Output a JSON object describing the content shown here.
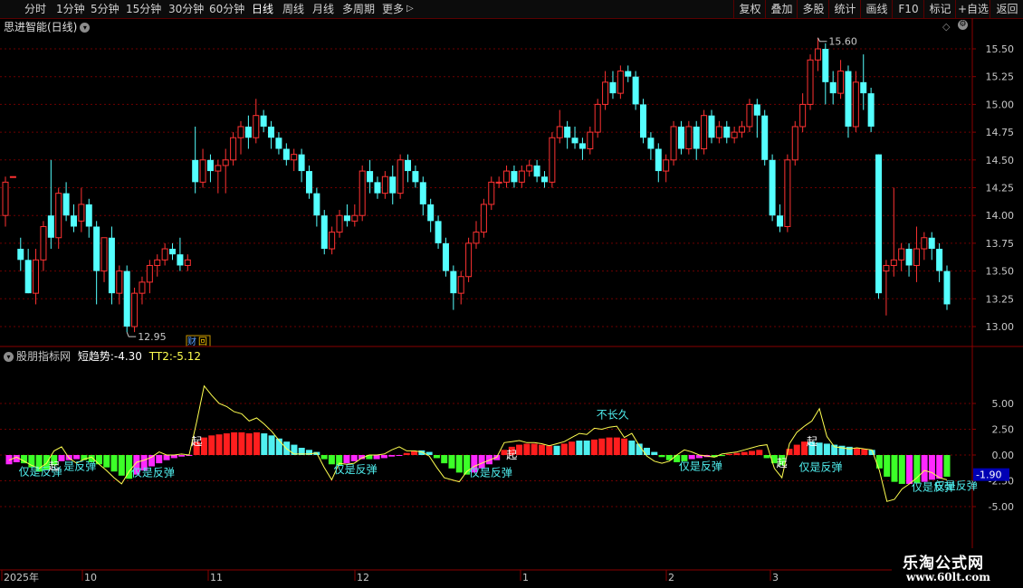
{
  "toolbar": {
    "periods": [
      "分时",
      "1分钟",
      "5分钟",
      "15分钟",
      "30分钟",
      "60分钟",
      "日线",
      "周线",
      "月线",
      "多周期",
      "更多"
    ],
    "active_period": "日线",
    "buttons": [
      "复权",
      "叠加",
      "多股",
      "统计",
      "画线",
      "F10",
      "标记",
      "+自选",
      "返回"
    ]
  },
  "main": {
    "title": "思进智能(日线)",
    "price_ticks": [
      "15.50",
      "15.25",
      "15.00",
      "14.75",
      "14.50",
      "14.25",
      "14.00",
      "13.75",
      "13.50",
      "13.25",
      "13.00"
    ],
    "high_label": "15.60",
    "low_label": "12.95",
    "badge": "财",
    "badge2": "回",
    "colors": {
      "up": "#ff3232",
      "down": "#54ffff",
      "grid": "#6e0000"
    },
    "candles": [
      [
        14.0,
        14.3,
        13.9,
        14.35
      ],
      [
        14.35,
        14.35,
        13.7,
        13.7
      ],
      [
        13.7,
        13.6,
        13.5,
        13.8
      ],
      [
        13.6,
        13.3,
        13.3,
        13.7
      ],
      [
        13.3,
        13.6,
        13.2,
        13.7
      ],
      [
        13.6,
        13.9,
        13.5,
        13.95
      ],
      [
        14.0,
        13.8,
        13.7,
        14.5
      ],
      [
        13.8,
        14.2,
        13.7,
        14.25
      ],
      [
        14.2,
        14.0,
        13.95,
        14.3
      ],
      [
        14.0,
        13.9,
        13.85,
        14.1
      ],
      [
        13.95,
        14.1,
        13.85,
        14.25
      ],
      [
        14.1,
        13.9,
        13.8,
        14.15
      ],
      [
        13.9,
        13.5,
        13.2,
        13.95
      ],
      [
        13.5,
        13.8,
        13.4,
        13.8
      ],
      [
        13.8,
        13.3,
        13.2,
        13.9
      ],
      [
        13.3,
        13.5,
        13.2,
        13.55
      ],
      [
        13.5,
        13.0,
        12.95,
        13.55
      ],
      [
        13.0,
        13.3,
        12.95,
        13.35
      ],
      [
        13.3,
        13.4,
        13.2,
        13.45
      ],
      [
        13.4,
        13.55,
        13.3,
        13.6
      ],
      [
        13.55,
        13.6,
        13.45,
        13.65
      ],
      [
        13.6,
        13.7,
        13.55,
        13.75
      ],
      [
        13.7,
        13.65,
        13.6,
        13.75
      ],
      [
        13.65,
        13.55,
        13.5,
        13.8
      ],
      [
        13.55,
        13.6,
        13.5,
        13.65
      ],
      [
        14.5,
        14.3,
        14.2,
        14.8
      ],
      [
        14.3,
        14.5,
        14.25,
        14.6
      ],
      [
        14.5,
        14.4,
        14.3,
        14.55
      ],
      [
        14.4,
        14.45,
        14.2,
        14.5
      ],
      [
        14.45,
        14.5,
        14.2,
        14.6
      ],
      [
        14.5,
        14.7,
        14.45,
        14.75
      ],
      [
        14.7,
        14.8,
        14.55,
        14.85
      ],
      [
        14.8,
        14.7,
        14.6,
        14.9
      ],
      [
        14.7,
        14.9,
        14.65,
        15.05
      ],
      [
        14.9,
        14.8,
        14.75,
        14.95
      ],
      [
        14.8,
        14.7,
        14.6,
        14.85
      ],
      [
        14.7,
        14.6,
        14.55,
        14.75
      ],
      [
        14.6,
        14.5,
        14.45,
        14.65
      ],
      [
        14.5,
        14.55,
        14.4,
        14.6
      ],
      [
        14.55,
        14.4,
        14.3,
        14.6
      ],
      [
        14.4,
        14.2,
        14.15,
        14.45
      ],
      [
        14.2,
        14.0,
        13.9,
        14.25
      ],
      [
        14.0,
        13.7,
        13.65,
        14.05
      ],
      [
        13.7,
        13.85,
        13.65,
        13.9
      ],
      [
        13.85,
        14.0,
        13.8,
        14.05
      ],
      [
        14.0,
        13.95,
        13.9,
        14.1
      ],
      [
        13.95,
        14.0,
        13.9,
        14.1
      ],
      [
        14.0,
        14.4,
        13.95,
        14.45
      ],
      [
        14.4,
        14.3,
        14.2,
        14.5
      ],
      [
        14.3,
        14.2,
        14.15,
        14.35
      ],
      [
        14.2,
        14.35,
        14.15,
        14.4
      ],
      [
        14.35,
        14.2,
        14.1,
        14.45
      ],
      [
        14.2,
        14.5,
        14.15,
        14.55
      ],
      [
        14.5,
        14.4,
        14.3,
        14.55
      ],
      [
        14.4,
        14.3,
        14.25,
        14.45
      ],
      [
        14.3,
        14.1,
        14.0,
        14.35
      ],
      [
        14.1,
        13.95,
        13.85,
        14.15
      ],
      [
        13.95,
        13.75,
        13.7,
        14.0
      ],
      [
        13.75,
        13.5,
        13.45,
        13.8
      ],
      [
        13.5,
        13.3,
        13.15,
        13.55
      ],
      [
        13.3,
        13.45,
        13.2,
        13.5
      ],
      [
        13.45,
        13.75,
        13.4,
        13.8
      ],
      [
        13.75,
        13.85,
        13.7,
        13.95
      ],
      [
        13.85,
        14.1,
        13.8,
        14.15
      ],
      [
        14.1,
        14.3,
        14.05,
        14.35
      ],
      [
        14.3,
        14.3,
        14.25,
        14.35
      ],
      [
        14.3,
        14.4,
        14.25,
        14.45
      ],
      [
        14.4,
        14.3,
        14.25,
        14.45
      ],
      [
        14.3,
        14.4,
        14.25,
        14.45
      ],
      [
        14.4,
        14.45,
        14.35,
        14.5
      ],
      [
        14.45,
        14.35,
        14.3,
        14.5
      ],
      [
        14.35,
        14.3,
        14.25,
        14.4
      ],
      [
        14.3,
        14.7,
        14.25,
        14.75
      ],
      [
        14.7,
        14.8,
        14.65,
        14.95
      ],
      [
        14.8,
        14.7,
        14.6,
        14.85
      ],
      [
        14.7,
        14.65,
        14.6,
        14.8
      ],
      [
        14.65,
        14.6,
        14.5,
        14.7
      ],
      [
        14.6,
        14.75,
        14.55,
        14.8
      ],
      [
        14.75,
        15.0,
        14.7,
        15.05
      ],
      [
        15.0,
        15.2,
        14.95,
        15.3
      ],
      [
        15.2,
        15.1,
        15.05,
        15.3
      ],
      [
        15.1,
        15.3,
        15.05,
        15.35
      ],
      [
        15.3,
        15.25,
        15.2,
        15.35
      ],
      [
        15.25,
        15.0,
        14.95,
        15.3
      ],
      [
        15.0,
        14.7,
        14.65,
        15.05
      ],
      [
        14.7,
        14.6,
        14.5,
        14.75
      ],
      [
        14.6,
        14.4,
        14.3,
        14.65
      ],
      [
        14.4,
        14.5,
        14.3,
        14.55
      ],
      [
        14.5,
        14.8,
        14.45,
        14.85
      ],
      [
        14.8,
        14.6,
        14.55,
        14.85
      ],
      [
        14.6,
        14.8,
        14.55,
        14.85
      ],
      [
        14.8,
        14.6,
        14.5,
        14.85
      ],
      [
        14.6,
        14.9,
        14.55,
        14.95
      ],
      [
        14.9,
        14.7,
        14.65,
        14.95
      ],
      [
        14.7,
        14.8,
        14.65,
        14.85
      ],
      [
        14.8,
        14.7,
        14.65,
        14.85
      ],
      [
        14.7,
        14.75,
        14.65,
        14.8
      ],
      [
        14.75,
        14.8,
        14.7,
        14.85
      ],
      [
        14.8,
        15.0,
        14.75,
        15.05
      ],
      [
        15.0,
        14.9,
        14.7,
        15.05
      ],
      [
        14.9,
        14.5,
        14.45,
        14.95
      ],
      [
        14.5,
        14.0,
        13.95,
        14.55
      ],
      [
        14.0,
        13.9,
        13.85,
        14.1
      ],
      [
        13.9,
        14.5,
        13.85,
        14.55
      ],
      [
        14.5,
        14.8,
        14.45,
        14.85
      ],
      [
        14.8,
        15.0,
        14.75,
        15.1
      ],
      [
        15.0,
        15.4,
        14.95,
        15.45
      ],
      [
        15.4,
        15.5,
        15.3,
        15.6
      ],
      [
        15.5,
        15.2,
        15.0,
        15.55
      ],
      [
        15.2,
        15.1,
        15.0,
        15.3
      ],
      [
        15.1,
        15.3,
        15.05,
        15.4
      ],
      [
        15.3,
        14.8,
        14.7,
        15.35
      ],
      [
        14.8,
        15.2,
        14.75,
        15.3
      ],
      [
        15.2,
        15.1,
        14.95,
        15.45
      ],
      [
        15.1,
        14.8,
        14.75,
        15.15
      ],
      [
        14.55,
        13.3,
        13.25,
        14.55
      ],
      [
        13.5,
        13.55,
        13.1,
        13.6
      ],
      [
        13.55,
        13.6,
        13.45,
        14.25
      ],
      [
        13.6,
        13.7,
        13.5,
        13.75
      ],
      [
        13.7,
        13.55,
        13.45,
        13.75
      ],
      [
        13.55,
        13.7,
        13.4,
        13.9
      ],
      [
        13.7,
        13.8,
        13.6,
        13.85
      ],
      [
        13.8,
        13.7,
        13.6,
        13.85
      ],
      [
        13.7,
        13.5,
        13.4,
        13.75
      ],
      [
        13.5,
        13.2,
        13.15,
        13.55
      ]
    ],
    "x_labels": [
      "2025年",
      "10",
      "11",
      "12",
      "1",
      "2",
      "3"
    ]
  },
  "indicator": {
    "name": "股朋指标网",
    "series1_label": "短趋势:",
    "series1_value": "-4.30",
    "series2_label": "TT2:",
    "series2_value": "-5.12",
    "ticks": [
      "5.00",
      "2.50",
      "0.00",
      "-2.50",
      "-5.00"
    ],
    "current_badge": "-1.90",
    "colors": {
      "red": "#ff1e1e",
      "cyan": "#50f0f0",
      "green": "#3cff28",
      "magenta": "#ff28ff",
      "line": "#ffff50",
      "text": "#50f0f0",
      "white": "#ffffff"
    },
    "bars": [
      [
        "m",
        -0.9
      ],
      [
        "m",
        -0.7
      ],
      [
        "g",
        -0.8
      ],
      [
        "g",
        -1.2
      ],
      [
        "g",
        -1.6
      ],
      [
        "g",
        -1.4
      ],
      [
        "g",
        -1.0
      ],
      [
        "m",
        -0.6
      ],
      [
        "m",
        -0.5
      ],
      [
        "m",
        -0.4
      ],
      [
        "g",
        -0.5
      ],
      [
        "g",
        -0.7
      ],
      [
        "g",
        -0.9
      ],
      [
        "g",
        -1.2
      ],
      [
        "g",
        -1.6
      ],
      [
        "g",
        -2.0
      ],
      [
        "g",
        -2.3
      ],
      [
        "m",
        -1.9
      ],
      [
        "m",
        -1.5
      ],
      [
        "m",
        -1.1
      ],
      [
        "m",
        -0.8
      ],
      [
        "m",
        -0.5
      ],
      [
        "m",
        -0.3
      ],
      [
        "m",
        -0.15
      ],
      [
        "m",
        -0.05
      ],
      [
        "r",
        1.3
      ],
      [
        "r",
        1.7
      ],
      [
        "r",
        1.9
      ],
      [
        "r",
        2.0
      ],
      [
        "r",
        2.1
      ],
      [
        "r",
        2.2
      ],
      [
        "r",
        2.2
      ],
      [
        "r",
        2.1
      ],
      [
        "r",
        2.2
      ],
      [
        "c",
        2.1
      ],
      [
        "c",
        1.9
      ],
      [
        "c",
        1.6
      ],
      [
        "c",
        1.3
      ],
      [
        "c",
        1.0
      ],
      [
        "c",
        0.7
      ],
      [
        "c",
        0.5
      ],
      [
        "c",
        0.3
      ],
      [
        "g",
        -0.4
      ],
      [
        "g",
        -0.9
      ],
      [
        "g",
        -1.0
      ],
      [
        "m",
        -0.8
      ],
      [
        "m",
        -0.6
      ],
      [
        "m",
        -0.4
      ],
      [
        "g",
        -0.4
      ],
      [
        "m",
        -0.4
      ],
      [
        "m",
        -0.3
      ],
      [
        "m",
        -0.15
      ],
      [
        "m",
        -0.05
      ],
      [
        "r",
        0.2
      ],
      [
        "r",
        0.35
      ],
      [
        "c",
        0.45
      ],
      [
        "c",
        0.3
      ],
      [
        "g",
        -0.3
      ],
      [
        "g",
        -0.8
      ],
      [
        "g",
        -1.3
      ],
      [
        "g",
        -1.7
      ],
      [
        "g",
        -1.9
      ],
      [
        "m",
        -1.7
      ],
      [
        "m",
        -1.3
      ],
      [
        "m",
        -0.9
      ],
      [
        "m",
        -0.5
      ],
      [
        "r",
        0.5
      ],
      [
        "r",
        0.8
      ],
      [
        "r",
        1.0
      ],
      [
        "r",
        1.1
      ],
      [
        "r",
        1.1
      ],
      [
        "r",
        1.0
      ],
      [
        "r",
        0.9
      ],
      [
        "c",
        0.9
      ],
      [
        "r",
        1.1
      ],
      [
        "r",
        1.3
      ],
      [
        "c",
        1.4
      ],
      [
        "c",
        1.4
      ],
      [
        "r",
        1.5
      ],
      [
        "r",
        1.6
      ],
      [
        "r",
        1.7
      ],
      [
        "r",
        1.7
      ],
      [
        "r",
        1.6
      ],
      [
        "c",
        1.4
      ],
      [
        "c",
        1.1
      ],
      [
        "c",
        0.7
      ],
      [
        "c",
        0.3
      ],
      [
        "g",
        -0.2
      ],
      [
        "g",
        -0.5
      ],
      [
        "g",
        -0.7
      ],
      [
        "g",
        -0.6
      ],
      [
        "m",
        -0.4
      ],
      [
        "m",
        -0.3
      ],
      [
        "m",
        -0.2
      ],
      [
        "g",
        -0.2
      ],
      [
        "g",
        -0.1
      ],
      [
        "r",
        0.1
      ],
      [
        "r",
        0.2
      ],
      [
        "r",
        0.3
      ],
      [
        "r",
        0.4
      ],
      [
        "r",
        0.5
      ],
      [
        "g",
        -0.3
      ],
      [
        "g",
        -0.8
      ],
      [
        "g",
        -1.0
      ],
      [
        "r",
        0.6
      ],
      [
        "r",
        1.0
      ],
      [
        "r",
        1.3
      ],
      [
        "c",
        1.3
      ],
      [
        "c",
        1.2
      ],
      [
        "c",
        1.1
      ],
      [
        "c",
        1.0
      ],
      [
        "c",
        0.9
      ],
      [
        "c",
        0.8
      ],
      [
        "r",
        0.7
      ],
      [
        "r",
        0.6
      ],
      [
        "c",
        0.5
      ],
      [
        "g",
        -1.3
      ],
      [
        "g",
        -2.1
      ],
      [
        "g",
        -2.6
      ],
      [
        "g",
        -2.8
      ],
      [
        "m",
        -2.8
      ],
      [
        "g",
        -2.7
      ],
      [
        "m",
        -2.6
      ],
      [
        "m",
        -2.4
      ],
      [
        "m",
        -2.3
      ],
      [
        "g",
        -2.1
      ]
    ],
    "line": [
      -0.5,
      -0.2,
      -0.6,
      -1.0,
      -1.3,
      -0.8,
      0.4,
      0.8,
      -0.3,
      -0.8,
      -0.4,
      -0.2,
      -0.9,
      -1.5,
      -2.2,
      -2.8,
      -1.6,
      -0.7,
      -0.5,
      -0.2,
      0.3,
      0.0,
      0.0,
      0.1,
      0.0,
      3.2,
      6.7,
      5.8,
      5.0,
      4.7,
      4.2,
      4.0,
      3.3,
      3.6,
      3.0,
      2.3,
      1.4,
      0.6,
      0.1,
      0.1,
      0.1,
      0.2,
      -1.2,
      -2.4,
      -0.8,
      -0.9,
      -0.8,
      -0.3,
      0.0,
      0.0,
      0.1,
      0.5,
      0.8,
      0.4,
      0.4,
      0.3,
      -0.1,
      -1.2,
      -2.2,
      -2.4,
      -2.6,
      -1.6,
      -1.1,
      -0.8,
      -0.5,
      -0.2,
      1.2,
      1.3,
      1.4,
      1.2,
      1.2,
      1.1,
      0.9,
      1.1,
      1.3,
      1.7,
      2.1,
      2.0,
      2.6,
      2.5,
      2.7,
      2.8,
      1.7,
      2.1,
      0.9,
      -0.1,
      -0.6,
      -0.8,
      -0.6,
      0.0,
      0.5,
      0.3,
      0.0,
      -0.1,
      -0.2,
      0.1,
      0.2,
      0.3,
      0.5,
      0.7,
      0.9,
      1.0,
      -1.3,
      -2.2,
      1.1,
      2.2,
      2.8,
      3.3,
      4.5,
      1.8,
      0.8,
      0.7,
      0.6,
      0.7,
      0.6,
      0.5,
      -1.5,
      -4.5,
      -4.3,
      -3.3,
      -2.8,
      -2.2,
      -1.5,
      -1.7,
      -2.2,
      -2.4
    ],
    "labels": [
      {
        "text": "仅是反弹",
        "bar": 2,
        "val": -0.9,
        "color": "text"
      },
      {
        "text": "起",
        "bar": 6,
        "val": -0.4,
        "color": "white"
      },
      {
        "text": "是反弹",
        "bar": 8,
        "val": -0.4,
        "color": "text"
      },
      {
        "text": "仅是反弹",
        "bar": 17,
        "val": -1.0,
        "color": "text"
      },
      {
        "text": "起",
        "bar": 25,
        "val": 2.0,
        "color": "white"
      },
      {
        "text": "仅是反弹",
        "bar": 44,
        "val": -0.7,
        "color": "text"
      },
      {
        "text": "仅是反弹",
        "bar": 62,
        "val": -1.0,
        "color": "text"
      },
      {
        "text": "起",
        "bar": 67,
        "val": 0.7,
        "color": "white"
      },
      {
        "text": "不长久",
        "bar": 79,
        "val": 4.6,
        "color": "text"
      },
      {
        "text": "仅是反弹",
        "bar": 90,
        "val": -0.4,
        "color": "text"
      },
      {
        "text": "起",
        "bar": 103,
        "val": -0.1,
        "color": "white"
      },
      {
        "text": "仅是反弹",
        "bar": 106,
        "val": -0.5,
        "color": "text"
      },
      {
        "text": "起",
        "bar": 107,
        "val": 2.0,
        "color": "white"
      },
      {
        "text": "仅是反弹",
        "bar": 121,
        "val": -2.4,
        "color": "text"
      },
      {
        "text": "仅是反弹",
        "bar": 124,
        "val": -2.3,
        "color": "text"
      }
    ]
  },
  "watermark": {
    "cn": "乐淘公式网",
    "url": "www.60lt.com"
  }
}
